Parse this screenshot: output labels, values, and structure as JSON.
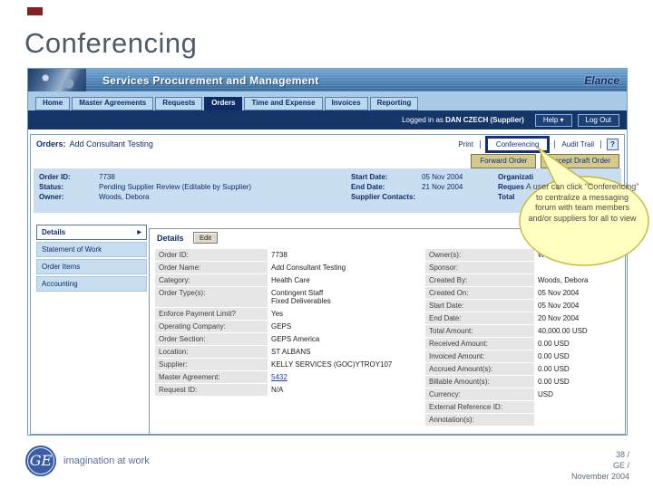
{
  "slide": {
    "title": "Conferencing",
    "ge": {
      "monogram": "GE",
      "tagline": "imagination at work"
    },
    "footer_lines": [
      "38 /",
      "GE /",
      "November 2004"
    ]
  },
  "callout": {
    "text": "A user can click “Conferencing” to centralize a messaging forum with team members and/or suppliers for all to view",
    "fill": "#ffffc2",
    "border": "#c6b73a"
  },
  "app": {
    "header": {
      "title": "Services Procurement and Management",
      "brand": "Elance"
    },
    "nav_tabs": [
      {
        "label": "Home"
      },
      {
        "label": "Master Agreements"
      },
      {
        "label": "Requests"
      },
      {
        "label": "Orders",
        "active": true
      },
      {
        "label": "Time and Expense"
      },
      {
        "label": "Invoices"
      },
      {
        "label": "Reporting"
      }
    ],
    "user_bar": {
      "logged_prefix": "Logged in as",
      "user_name": "DAN CZECH (Supplier)",
      "help_label": "Help",
      "help_arrow": "▾",
      "logout_label": "Log Out"
    },
    "order_bar": {
      "label": "Orders:",
      "order_name": "Add Consultant Testing",
      "links": [
        "Print",
        "Conferencing",
        "Audit Trail"
      ],
      "help_icon": "?"
    },
    "actions": [
      "Forward Order",
      "Accept Draft Order"
    ],
    "summary": {
      "col1": [
        {
          "label": "Order ID:",
          "value": "7738"
        },
        {
          "label": "Status:",
          "value": "Pending Supplier Review (Editable by Supplier)"
        },
        {
          "label": "Owner:",
          "value": "Woods, Debora"
        }
      ],
      "col2": [
        {
          "label": "Start Date:",
          "value": "05 Nov 2004"
        },
        {
          "label": "End Date:",
          "value": "21 Nov 2004"
        },
        {
          "label": "Supplier Contacts:",
          "value": ""
        }
      ],
      "col3": [
        {
          "label": "Organizati",
          "value": ""
        },
        {
          "label": "Reques",
          "value": ""
        },
        {
          "label": "Total",
          "value": ""
        }
      ]
    },
    "sidebar_items": [
      {
        "label": "Details",
        "active": true,
        "arrow": "▶"
      },
      {
        "label": "Statement of Work"
      },
      {
        "label": "Order Items"
      },
      {
        "label": "Accounting"
      }
    ],
    "details": {
      "heading": "Details",
      "edit_label": "Edit",
      "left_rows": [
        {
          "label": "Order ID:",
          "value": "7738"
        },
        {
          "label": "Order Name:",
          "value": "Add Consultant Testing"
        },
        {
          "label": "Category:",
          "value": "Health Care"
        },
        {
          "label": "Order Type(s):",
          "value": "Contingent Staff\nFixed Deliverables"
        },
        {
          "label": "Enforce Payment Limit?",
          "value": "Yes"
        },
        {
          "label": "Operating Company:",
          "value": "GEPS"
        },
        {
          "label": "Order Section:",
          "value": "GEPS America"
        },
        {
          "label": "Location:",
          "value": "ST ALBANS"
        },
        {
          "label": "Supplier:",
          "value": "KELLY SERVICES (GOC)YTROY107"
        },
        {
          "label": "Master Agreement:",
          "value": "5432",
          "link": true
        },
        {
          "label": "Request ID:",
          "value": "N/A"
        }
      ],
      "right_rows": [
        {
          "label": "Owner(s):",
          "value": "Woods, Debora"
        },
        {
          "label": "Sponsor:",
          "value": ""
        },
        {
          "label": "Created By:",
          "value": "Woods, Debora"
        },
        {
          "label": "Created On:",
          "value": "05 Nov 2004"
        },
        {
          "label": "Start Date:",
          "value": "05 Nov 2004"
        },
        {
          "label": "End Date:",
          "value": "20 Nov 2004"
        },
        {
          "label": "Total Amount:",
          "value": "40,000.00 USD"
        },
        {
          "label": "Received Amount:",
          "value": "0.00 USD"
        },
        {
          "label": "Invoiced Amount:",
          "value": "0.00 USD"
        },
        {
          "label": "Accrued Amount(s):",
          "value": "0.00 USD"
        },
        {
          "label": "Billable Amount(s):",
          "value": "0.00 USD"
        },
        {
          "label": "Currency:",
          "value": "USD"
        },
        {
          "label": "External Reference ID:",
          "value": ""
        },
        {
          "label": "Annotation(s):",
          "value": ""
        }
      ]
    },
    "colors": {
      "navy": "#0e2d68",
      "panel_blue": "#c9def0",
      "header_blue": "#4a86ba"
    }
  }
}
